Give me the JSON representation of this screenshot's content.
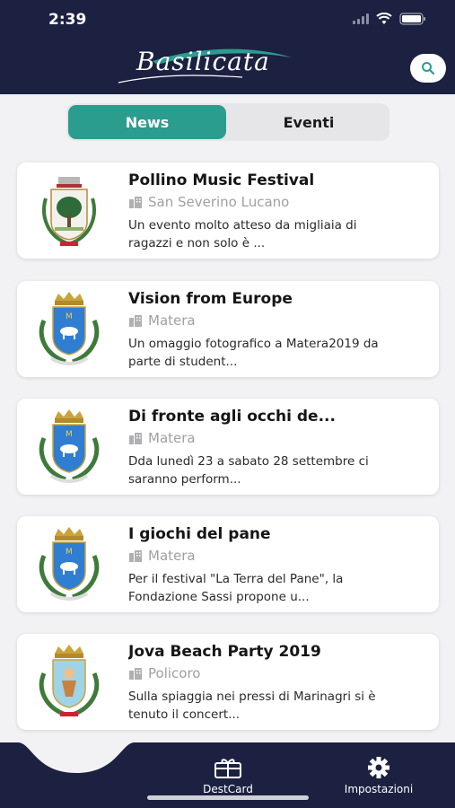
{
  "status": {
    "time": "2:39"
  },
  "header": {
    "logo_text": "Basilicata",
    "search_icon": "search-icon"
  },
  "tabs": {
    "news": "News",
    "eventi": "Eventi"
  },
  "news": [
    {
      "title": "Pollino Music Festival",
      "location": "San Severino Lucano",
      "description": "Un evento molto atteso da migliaia di ragazzi e non solo è ..."
    },
    {
      "title": "Vision from Europe",
      "location": "Matera",
      "description": "Un omaggio fotografico a Matera2019 da parte di student..."
    },
    {
      "title": "Di fronte agli occhi de...",
      "location": "Matera",
      "description": "Dda lunedì 23 a sabato 28 settembre ci saranno perform..."
    },
    {
      "title": "I giochi del pane",
      "location": "Matera",
      "description": "Per il festival \"La Terra del Pane\", la Fondazione Sassi propone u..."
    },
    {
      "title": "Jova Beach Party 2019",
      "location": "Policoro",
      "description": "Sulla spiaggia nei pressi di Marinagri si è tenuto il concert..."
    }
  ],
  "bottom_nav": {
    "destcard": "DestCard",
    "impostazioni": "Impostazioni"
  },
  "colors": {
    "navy": "#1c2142",
    "teal": "#2a9d8f"
  }
}
